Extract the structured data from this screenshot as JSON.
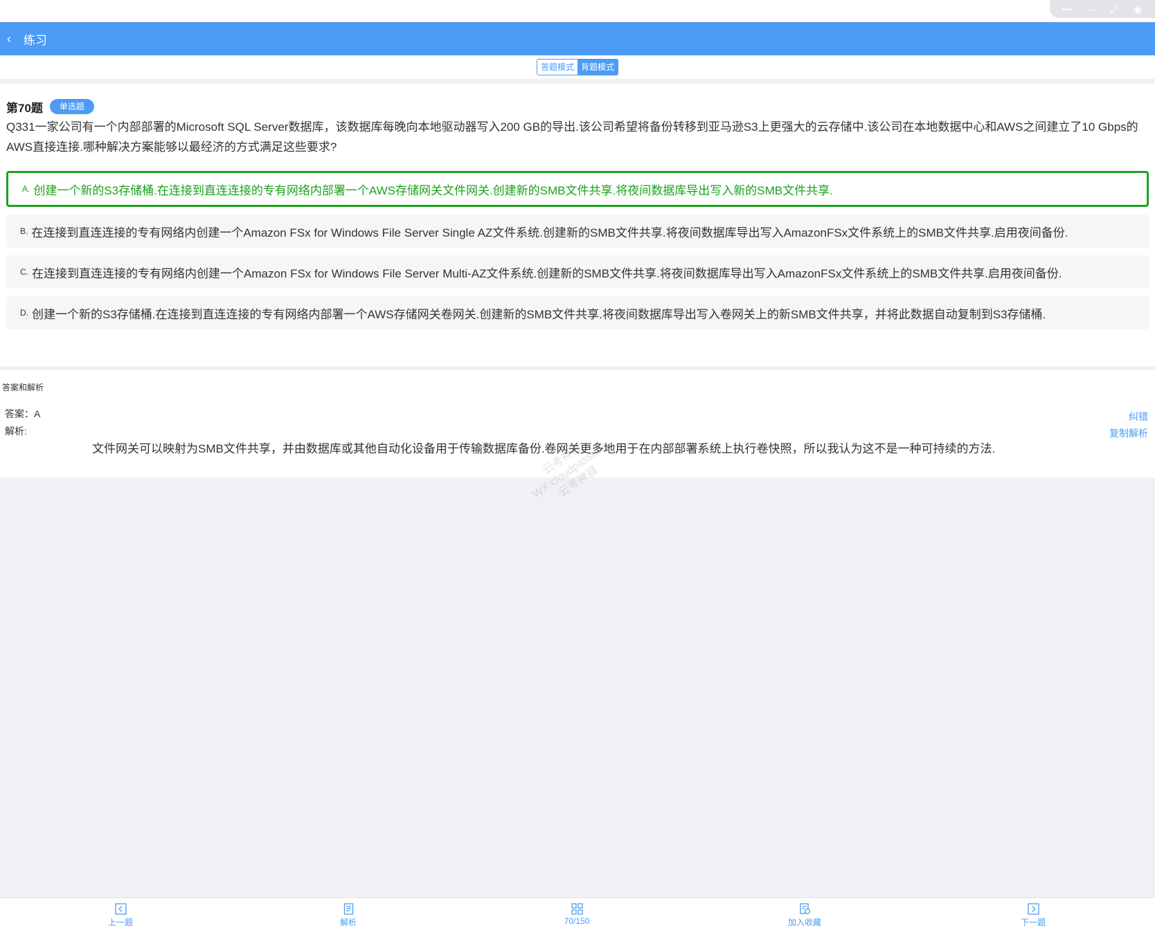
{
  "window_controls": [
    "more-icon",
    "minimize-icon",
    "restore-icon",
    "close-icon"
  ],
  "nav": {
    "back_icon": "chevron-left-icon",
    "title": "练习"
  },
  "mode": {
    "answer_mode": "答题模式",
    "memorize_mode": "背题模式",
    "active": "背题模式"
  },
  "question": {
    "number": "第70题",
    "type": "单选题",
    "text": "Q331一家公司有一个内部部署的Microsoft SQL Server数据库，该数据库每晚向本地驱动器写入200 GB的导出.该公司希望将备份转移到亚马逊S3上更强大的云存储中.该公司在本地数据中心和AWS之间建立了10 Gbps的AWS直接连接.哪种解决方案能够以最经济的方式满足这些要求?",
    "options": [
      {
        "letter": "A.",
        "text": "创建一个新的S3存储桶.在连接到直连连接的专有网络内部署一个AWS存储网关文件网关.创建新的SMB文件共享.将夜间数据库导出写入新的SMB文件共享."
      },
      {
        "letter": "B.",
        "text": "在连接到直连连接的专有网络内创建一个Amazon FSx for Windows File Server Single AZ文件系统.创建新的SMB文件共享.将夜间数据库导出写入AmazonFSx文件系统上的SMB文件共享.启用夜间备份."
      },
      {
        "letter": "C.",
        "text": "在连接到直连连接的专有网络内创建一个Amazon FSx for Windows File Server Multi-AZ文件系统.创建新的SMB文件共享.将夜间数据库导出写入AmazonFSx文件系统上的SMB文件共享.启用夜间备份."
      },
      {
        "letter": "D.",
        "text": "创建一个新的S3存储桶.在连接到直连连接的专有网络内部署一个AWS存储网关卷网关.创建新的SMB文件共享.将夜间数据库导出写入卷网关上的新SMB文件共享，并将此数据自动复制到S3存储桶."
      }
    ],
    "correct_option": "A."
  },
  "answer": {
    "header": "答案和解析",
    "answer_line": "答案：A",
    "explanation_label": "解析:",
    "explanation": "文件网关可以映射为SMB文件共享，并由数据库或其他自动化设备用于传输数据库备份.卷网关更多地用于在内部部署系统上执行卷快照，所以我认为这不是一种可持续的方法.",
    "report_error": "纠错",
    "copy_explanation": "复制解析"
  },
  "watermark": [
    "云考神器",
    "WX:cloudpassonc",
    "云考神器"
  ],
  "bottom_nav": {
    "prev": {
      "label": "上一题",
      "icon": "arrow-left-box-icon"
    },
    "analysis": {
      "label": "解析",
      "icon": "document-icon"
    },
    "progress": {
      "label": "70/150",
      "icon": "grid-icon"
    },
    "favorite": {
      "label": "加入收藏",
      "icon": "bookmark-icon"
    },
    "next": {
      "label": "下一题",
      "icon": "arrow-right-box-icon"
    }
  },
  "colors": {
    "primary": "#4c9bf5",
    "correct": "#1aa31a",
    "background": "#f0f0f5"
  }
}
